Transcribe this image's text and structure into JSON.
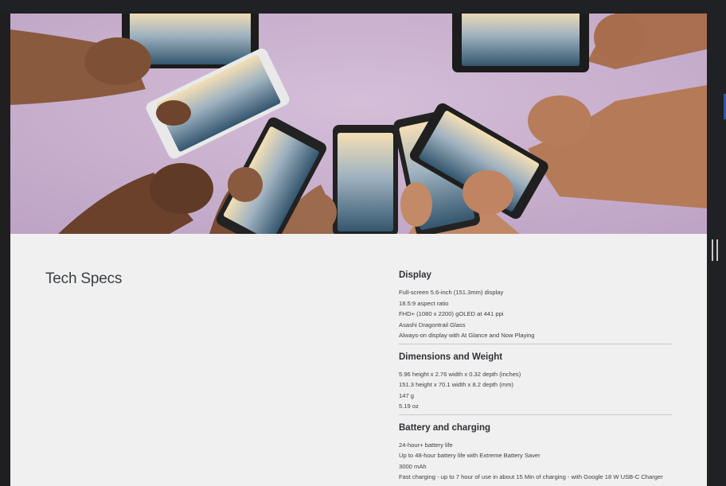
{
  "hero": {
    "background_color": "#c9b1cf",
    "screen_gradient": [
      "#f4dfb5",
      "#6f8ea6",
      "#34566e"
    ]
  },
  "specs": {
    "title": "Tech Specs",
    "sections": [
      {
        "heading": "Display",
        "lines": [
          "Full-screen 5.6-inch (151.3mm) display",
          "18.5:9 aspect ratio",
          "FHD+ (1080 x 2200) gOLED at 441 ppi",
          "Asashi Dragontrail Glass",
          "Always-on display with At Glance and Now Playing"
        ]
      },
      {
        "heading": "Dimensions and Weight",
        "lines": [
          "5.96 height x 2.76 width x 0.32 depth (inches)",
          "151.3 height x 70.1 width x 8.2 depth (mm)",
          "147 g",
          "5.19 oz"
        ]
      },
      {
        "heading": "Battery and charging",
        "lines": [
          "24-hour+ battery life",
          "Up to 48-hour battery life with Extreme Battery Saver",
          "3000 mAh",
          "Fast charging - up to 7 hour of use in about 15 Min of charging - with Google 18 W USB-C Charger"
        ]
      }
    ]
  }
}
